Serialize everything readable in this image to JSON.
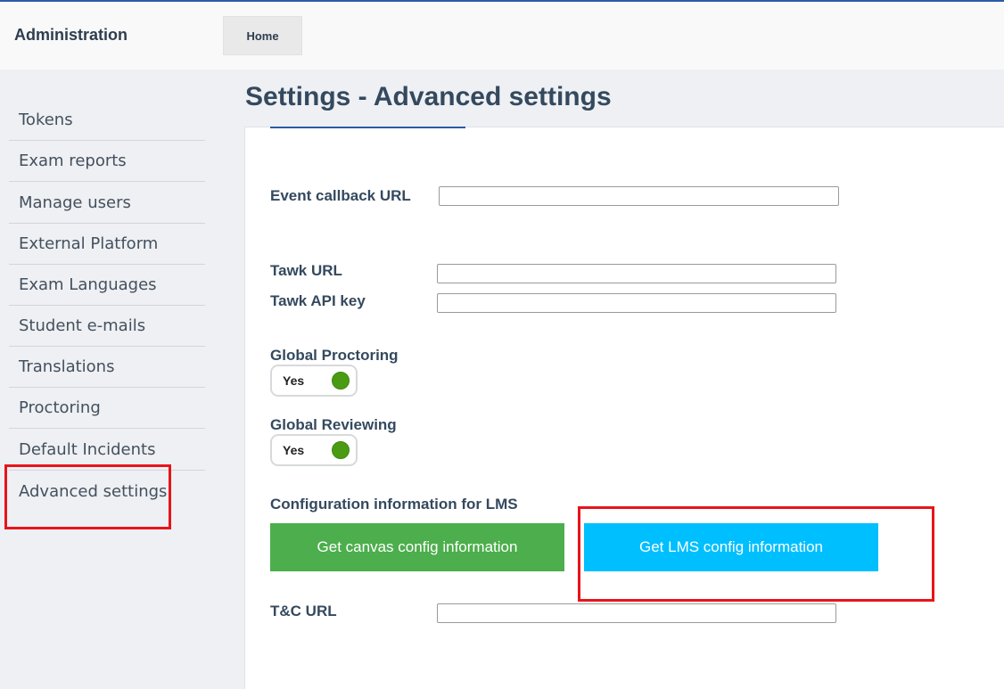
{
  "header": {
    "brand": "Administration",
    "home_tab": "Home"
  },
  "sidebar": {
    "items": [
      {
        "label": "Tokens"
      },
      {
        "label": "Exam reports"
      },
      {
        "label": "Manage users"
      },
      {
        "label": "External Platform"
      },
      {
        "label": "Exam Languages"
      },
      {
        "label": "Student e-mails"
      },
      {
        "label": "Translations"
      },
      {
        "label": "Proctoring"
      },
      {
        "label": "Default Incidents"
      },
      {
        "label": "Advanced settings"
      }
    ]
  },
  "main": {
    "title": "Settings - Advanced settings",
    "event_callback": {
      "label": "Event callback URL",
      "value": ""
    },
    "tawk_url": {
      "label": "Tawk URL",
      "value": ""
    },
    "tawk_api_key": {
      "label": "Tawk API key",
      "value": ""
    },
    "global_proctoring": {
      "label": "Global Proctoring",
      "toggle_text": "Yes",
      "enabled": true
    },
    "global_reviewing": {
      "label": "Global Reviewing",
      "toggle_text": "Yes",
      "enabled": true
    },
    "lms_config": {
      "label": "Configuration information for LMS",
      "canvas_button": "Get canvas config information",
      "lms_button": "Get LMS config information"
    },
    "tc_url": {
      "label": "T&C URL",
      "value": ""
    }
  },
  "colors": {
    "accent": "#2b5aa8",
    "canvas_button": "#4cae4c",
    "lms_button": "#00bfff",
    "toggle_on": "#4a9a14",
    "highlight": "#e8141b"
  }
}
